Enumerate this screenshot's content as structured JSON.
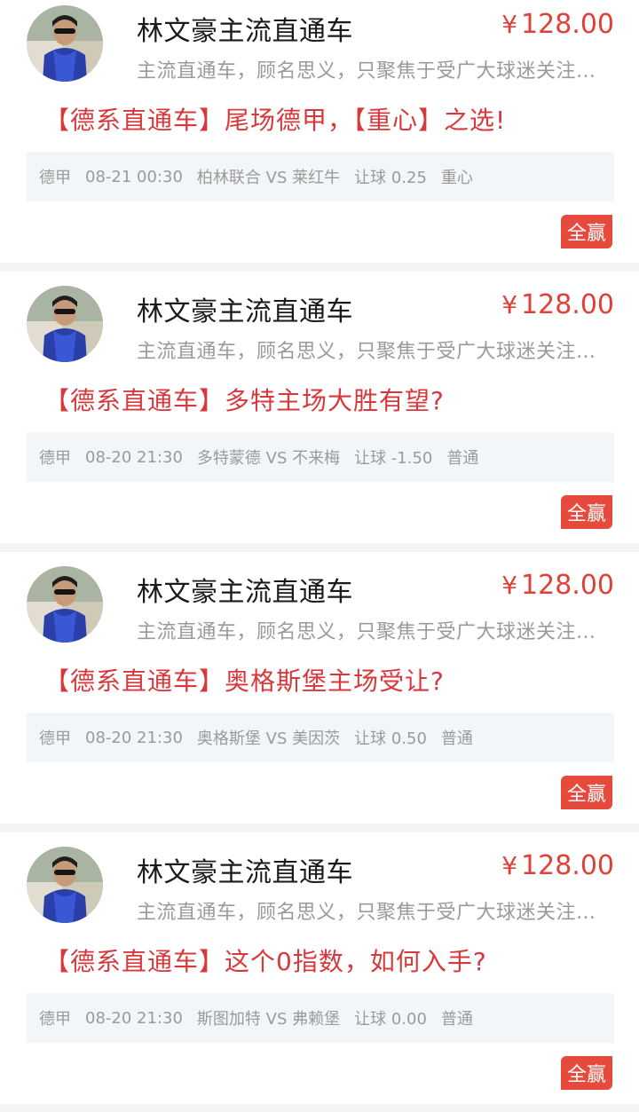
{
  "colors": {
    "price": "#e0403a",
    "title": "#d8383c",
    "badge_bg": "#e64a3c",
    "match_bg": "#f3f6f9",
    "muted_text": "#9a9a9a"
  },
  "posts": [
    {
      "avatar_icon": "author-avatar-photo",
      "author": "林文豪主流直通车",
      "currency": "¥",
      "price": "128.00",
      "intro": "主流直通车，顾名思义，只聚焦于受广大球迷关注…",
      "title": "【德系直通车】尾场德甲，【重心】之选!",
      "match": {
        "league": "德甲",
        "time": "08-21 00:30",
        "teams": "柏林联合 VS 莱红牛",
        "handicap": "让球 0.25",
        "tag": "重心"
      },
      "result": "全赢"
    },
    {
      "avatar_icon": "author-avatar-photo",
      "author": "林文豪主流直通车",
      "currency": "¥",
      "price": "128.00",
      "intro": "主流直通车，顾名思义，只聚焦于受广大球迷关注…",
      "title": "【德系直通车】多特主场大胜有望?",
      "match": {
        "league": "德甲",
        "time": "08-20 21:30",
        "teams": "多特蒙德 VS 不来梅",
        "handicap": "让球 -1.50",
        "tag": "普通"
      },
      "result": "全赢"
    },
    {
      "avatar_icon": "author-avatar-photo",
      "author": "林文豪主流直通车",
      "currency": "¥",
      "price": "128.00",
      "intro": "主流直通车，顾名思义，只聚焦于受广大球迷关注…",
      "title": "【德系直通车】奥格斯堡主场受让?",
      "match": {
        "league": "德甲",
        "time": "08-20 21:30",
        "teams": "奥格斯堡 VS 美因茨",
        "handicap": "让球 0.50",
        "tag": "普通"
      },
      "result": "全赢"
    },
    {
      "avatar_icon": "author-avatar-photo",
      "author": "林文豪主流直通车",
      "currency": "¥",
      "price": "128.00",
      "intro": "主流直通车，顾名思义，只聚焦于受广大球迷关注…",
      "title": "【德系直通车】这个0指数，如何入手?",
      "match": {
        "league": "德甲",
        "time": "08-20 21:30",
        "teams": "斯图加特 VS 弗赖堡",
        "handicap": "让球 0.00",
        "tag": "普通"
      },
      "result": "全赢"
    }
  ]
}
